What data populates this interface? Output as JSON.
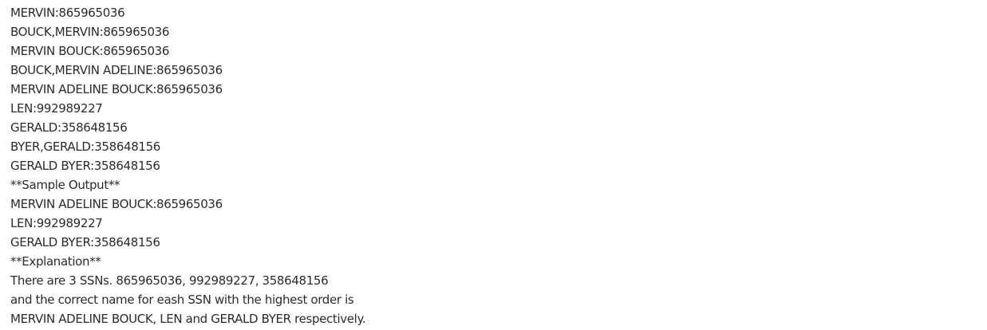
{
  "content": {
    "lines": [
      "MERVIN:865965036",
      "BOUCK,MERVIN:865965036",
      "MERVIN BOUCK:865965036",
      "BOUCK,MERVIN ADELINE:865965036",
      "MERVIN ADELINE BOUCK:865965036",
      "LEN:992989227",
      "GERALD:358648156",
      "BYER,GERALD:358648156",
      "GERALD BYER:358648156",
      "**Sample Output**",
      "MERVIN ADELINE BOUCK:865965036",
      "LEN:992989227",
      "GERALD BYER:358648156",
      "**Explanation**",
      "There are 3 SSNs. 865965036, 992989227, 358648156",
      "and the correct name for eash SSN with the highest order is",
      "MERVIN ADELINE BOUCK, LEN and GERALD BYER respectively."
    ]
  }
}
